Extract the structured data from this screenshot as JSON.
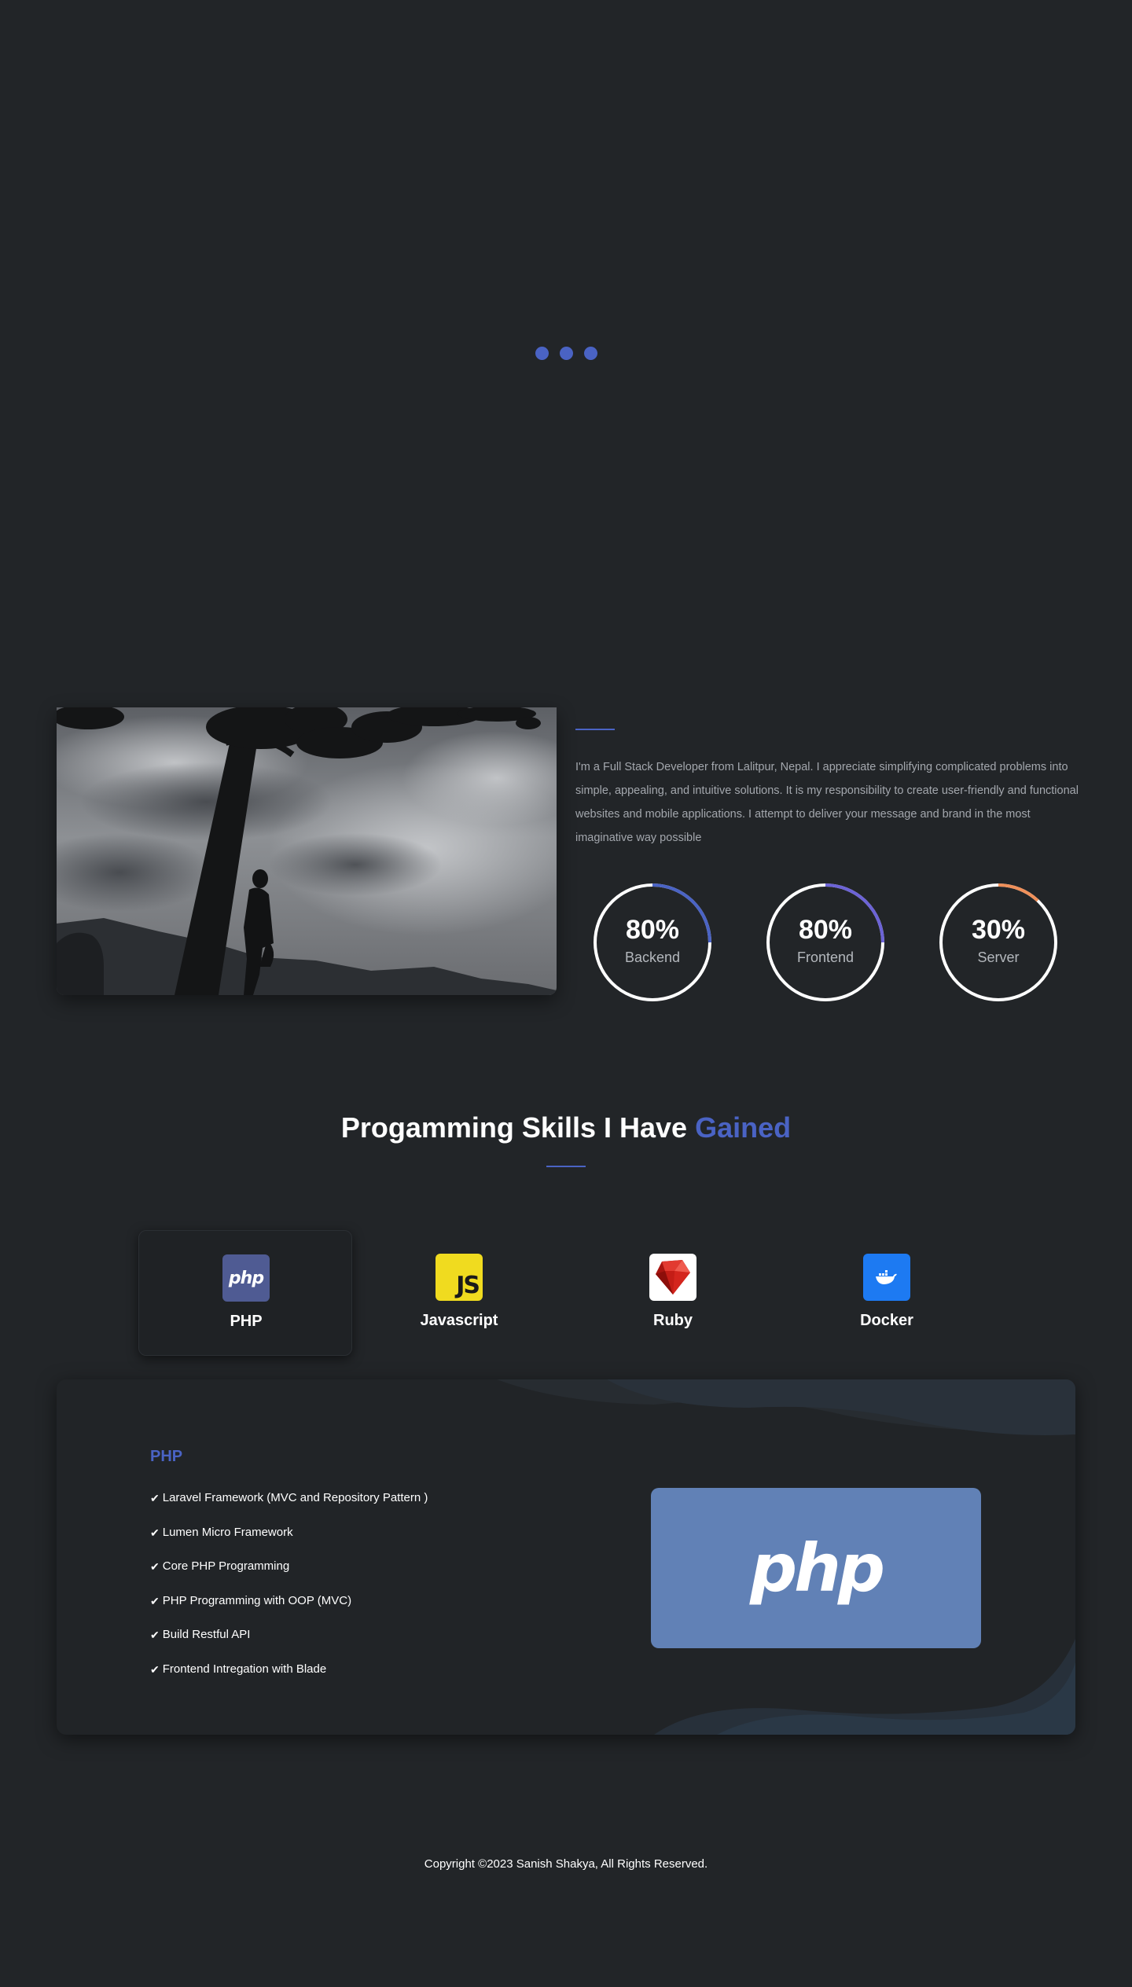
{
  "colors": {
    "background": "#222528",
    "accent": "#4a63c4",
    "card": "#212427",
    "php_tile": "#4f5b93",
    "js_tile": "#f0db1f",
    "docker_tile": "#1d7af2",
    "php_banner": "#6181b6",
    "backend_ring": "#4a63c4",
    "frontend_ring": "#6c63d6",
    "server_ring": "#f0905a"
  },
  "loader": {
    "dots": 3
  },
  "about": {
    "image": "profile-silhouette-under-tree",
    "text": "I'm a Full Stack Developer from Lalitpur, Nepal. I appreciate simplifying complicated problems into simple, appealing, and intuitive solutions. It is my responsibility to create user-friendly and functional websites and mobile applications. I attempt to deliver your message and brand in the most imaginative way possible",
    "stats": [
      {
        "value": "80%",
        "label": "Backend",
        "fraction": 0.25,
        "color": "#4a63c4"
      },
      {
        "value": "80%",
        "label": "Frontend",
        "fraction": 0.25,
        "color": "#6c63d6"
      },
      {
        "value": "30%",
        "label": "Server",
        "fraction": 0.12,
        "color": "#f0905a"
      }
    ]
  },
  "skills": {
    "title_main": "Progamming Skills I Have",
    "title_accent": "Gained",
    "tabs": [
      {
        "label": "PHP",
        "icon": "php-icon",
        "active": true
      },
      {
        "label": "Javascript",
        "icon": "javascript-icon",
        "active": false
      },
      {
        "label": "Ruby",
        "icon": "ruby-icon",
        "active": false
      },
      {
        "label": "Docker",
        "icon": "docker-icon",
        "active": false
      }
    ],
    "tab_icon_text": {
      "php": "php",
      "js": "JS"
    }
  },
  "detail": {
    "heading": "PHP",
    "items": [
      "Laravel Framework (MVC and Repository Pattern )",
      "Lumen Micro Framework",
      "Core PHP Programming",
      "PHP Programming with OOP (MVC)",
      "Build Restful API",
      "Frontend Intregation with Blade"
    ],
    "item_spacing": [
      " ",
      "",
      " ",
      " ",
      " ",
      ""
    ],
    "check_icon": "checkmark-icon",
    "banner_logo": "php"
  },
  "footer": {
    "copyright": "Copyright ©2023 Sanish Shakya, All Rights Reserved."
  }
}
